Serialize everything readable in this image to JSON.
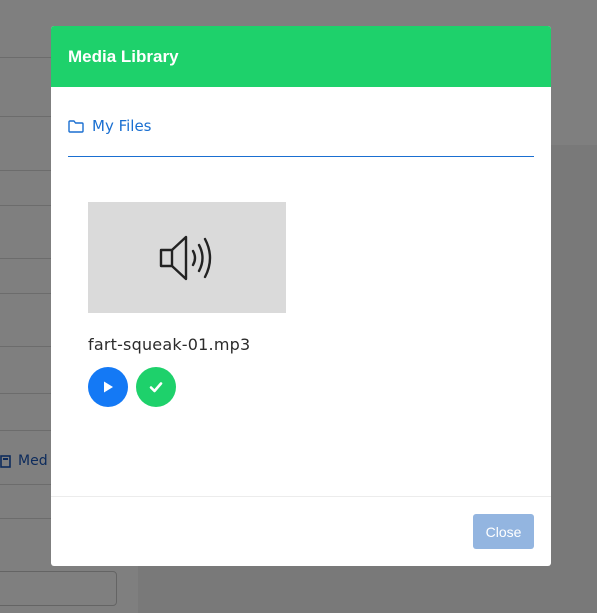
{
  "background": {
    "media_link_label": "Med"
  },
  "modal": {
    "title": "Media Library",
    "folder_label": "My Files",
    "files": [
      {
        "name": "fart-squeak-01.mp3",
        "thumb_icon": "speaker-icon"
      }
    ],
    "close_label": "Close"
  },
  "colors": {
    "header": "#1ed16b",
    "accent_blue": "#1a6fd1",
    "play_button": "#1479f5",
    "select_button": "#1ed16b",
    "close_button": "#93b5e0"
  }
}
